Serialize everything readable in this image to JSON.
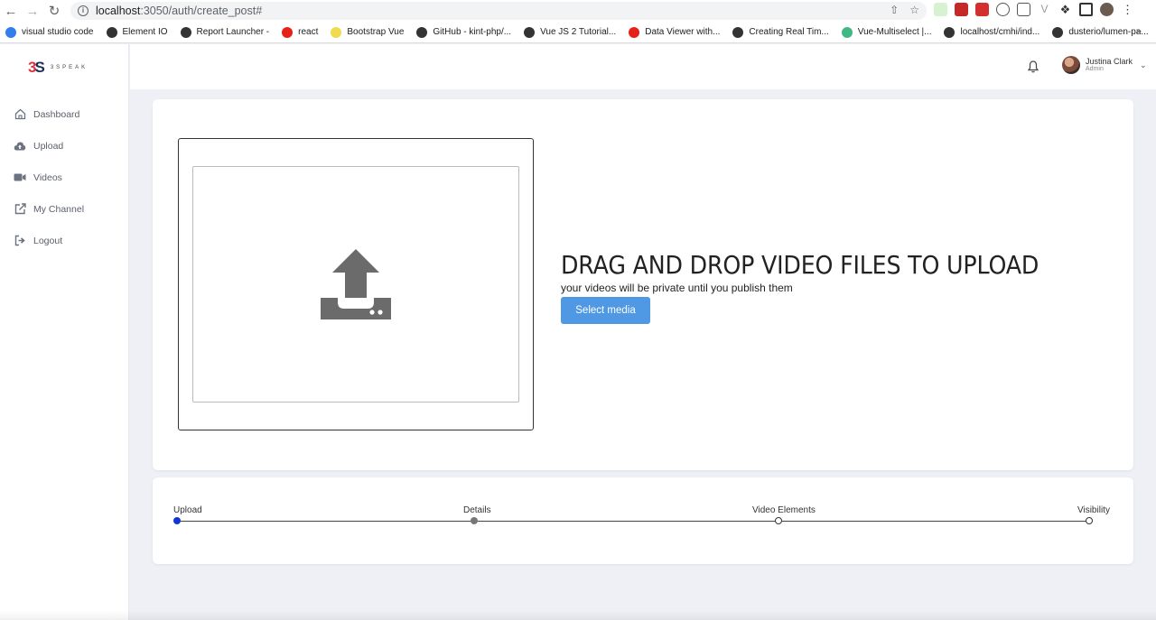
{
  "browser": {
    "url_host": "localhost",
    "url_path": ":3050/auth/create_post#",
    "bookmarks": [
      {
        "label": "visual studio code",
        "color": "#2f80ed"
      },
      {
        "label": "Element IO",
        "color": "#333333"
      },
      {
        "label": "Report Launcher -",
        "color": "#333333"
      },
      {
        "label": "react",
        "color": "#e62117"
      },
      {
        "label": "Bootstrap Vue",
        "color": "#f0db4f"
      },
      {
        "label": "GitHub - kint-php/...",
        "color": "#333333"
      },
      {
        "label": "Vue JS 2 Tutorial...",
        "color": "#333333"
      },
      {
        "label": "Data Viewer with...",
        "color": "#e62117"
      },
      {
        "label": "Creating Real Tim...",
        "color": "#333333"
      },
      {
        "label": "Vue-Multiselect |...",
        "color": "#41b883"
      },
      {
        "label": "localhost/cmhi/ind...",
        "color": "#333333"
      },
      {
        "label": "dusterio/lumen-pa...",
        "color": "#333333"
      }
    ],
    "more_label": "»"
  },
  "app": {
    "logo_text": "3SPEAK",
    "menu": [
      {
        "label": "Dashboard",
        "icon": "home-icon"
      },
      {
        "label": "Upload",
        "icon": "cloud-upload-icon"
      },
      {
        "label": "Videos",
        "icon": "video-icon"
      },
      {
        "label": "My Channel",
        "icon": "external-link-icon"
      },
      {
        "label": "Logout",
        "icon": "logout-icon"
      }
    ],
    "user": {
      "name": "Justina Clark",
      "role": "Admin"
    }
  },
  "upload": {
    "title": "DRAG AND DROP VIDEO FILES TO UPLOAD",
    "subtitle": "your videos will be private until you publish them",
    "button_label": "Select media"
  },
  "steps": [
    {
      "label": "Upload",
      "state": "active"
    },
    {
      "label": "Details",
      "state": "done"
    },
    {
      "label": "Video Elements",
      "state": "pending"
    },
    {
      "label": "Visibility",
      "state": "pending"
    }
  ],
  "colors": {
    "accent": "#4f98e3",
    "active_step": "#1235d8"
  }
}
